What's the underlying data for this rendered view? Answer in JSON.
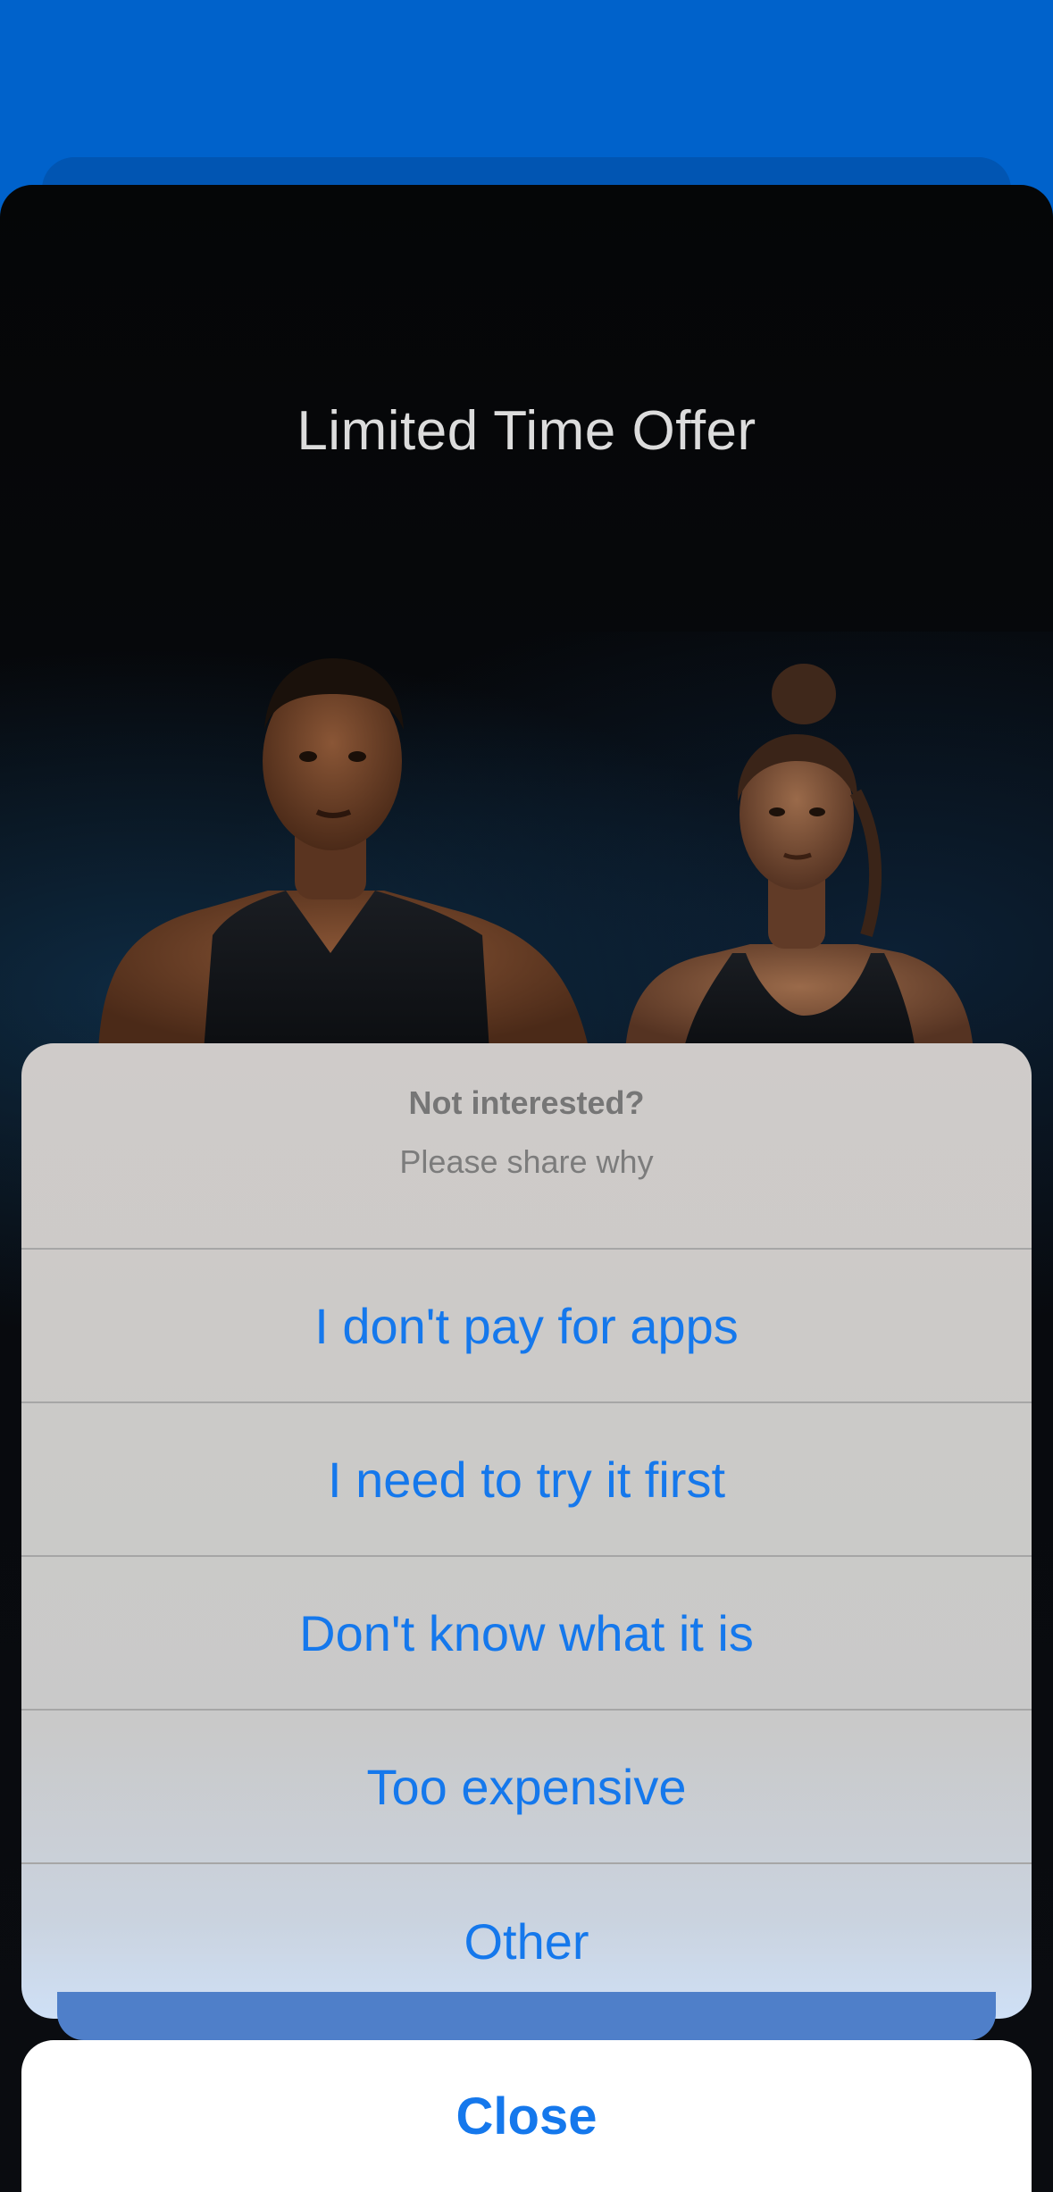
{
  "offer": {
    "title": "Limited Time Offer"
  },
  "hero": {
    "image": "athletes-photo"
  },
  "action_sheet": {
    "title": "Not interested?",
    "subtitle": "Please share why",
    "options": [
      {
        "label": "I don't pay for apps"
      },
      {
        "label": "I need to try it first"
      },
      {
        "label": "Don't know what it is"
      },
      {
        "label": "Too expensive"
      },
      {
        "label": "Other"
      }
    ],
    "close_label": "Close"
  },
  "colors": {
    "background_blue": "#0062CB",
    "action_text": "#1578EC",
    "sheet_dark": "#050607"
  }
}
